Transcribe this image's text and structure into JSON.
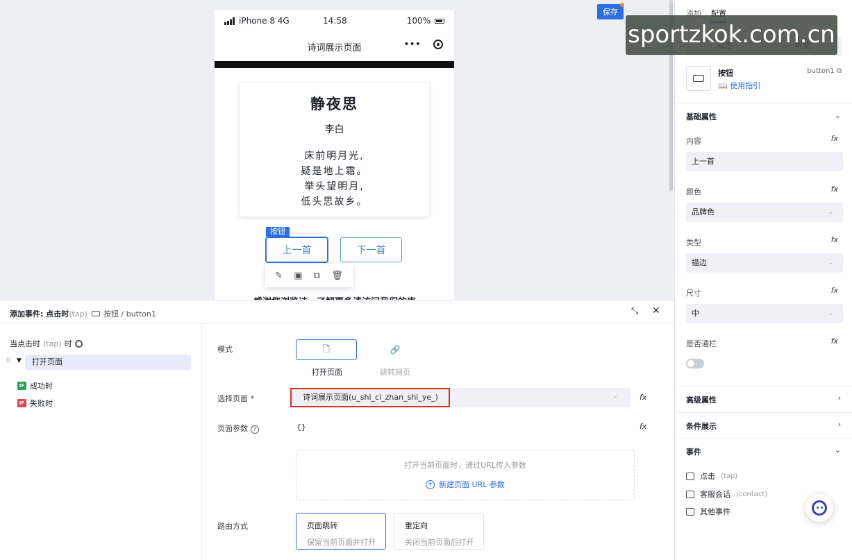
{
  "phone": {
    "carrier": "iPhone 8",
    "network": "4G",
    "time": "14:58",
    "battery": "100%",
    "page_title": "诗词展示页面",
    "more_glyph": "•••",
    "poem": {
      "title": "静夜思",
      "author": "李白",
      "lines": [
        "床前明月光,",
        "疑是地上霜。",
        "举头望明月,",
        "低头思故乡。"
      ]
    },
    "selected_tag": "按钮",
    "prev_button": "上一首",
    "next_button": "下一首",
    "footer_text": "感谢您浏览诗，了解更多请访问我们的库"
  },
  "right_panel": {
    "tabs": [
      "添加",
      "配置"
    ],
    "active_tab": "配置",
    "segments": [
      "属性",
      "样式"
    ],
    "component": {
      "name": "按钮",
      "guide": "使用指引",
      "id": "button1"
    },
    "basic_section": "基础属性",
    "fields": [
      {
        "label": "内容",
        "value": "上一首"
      },
      {
        "label": "颜色",
        "value": "品牌色"
      },
      {
        "label": "类型",
        "value": "描边"
      },
      {
        "label": "尺寸",
        "value": "中"
      }
    ],
    "block_label": "是否通栏",
    "fx": "fx",
    "advanced_section": "高级属性",
    "condition_section": "条件展示",
    "events_section": "事件",
    "events": [
      {
        "label": "点击",
        "sub": "(tap)"
      },
      {
        "label": "客服会话",
        "sub": "(contact)"
      },
      {
        "label": "其他事件",
        "sub": ""
      }
    ]
  },
  "watermark": "sportzkok.com.cn",
  "event_panel": {
    "title": "添加事件: 点击时",
    "title_sub": "(tap)",
    "path": "按钮 / button1",
    "save": "保存",
    "trigger": "当点击时",
    "trigger_sub": "(tap)",
    "trigger_suffix": "时",
    "action": "打开页面",
    "on_success": "成功时",
    "on_fail": "失败时",
    "if_badge": "IF",
    "mode_label": "模式",
    "mode_options": [
      "打开页面",
      "跳转网页"
    ],
    "select_page_label": "选择页面 *",
    "selected_page": "诗词展示页面(u_shi_ci_zhan_shi_ye_)",
    "params_label": "页面参数",
    "params_value": "{}",
    "params_hint": "打开当前页面时，通过URL传入参数",
    "add_param": "新建页面 URL 参数",
    "route_label": "路由方式",
    "routes": [
      {
        "title": "页面跳转",
        "sub": "保留当前页面并打开"
      },
      {
        "title": "重定向",
        "sub": "关闭当前页面后打开"
      }
    ]
  }
}
